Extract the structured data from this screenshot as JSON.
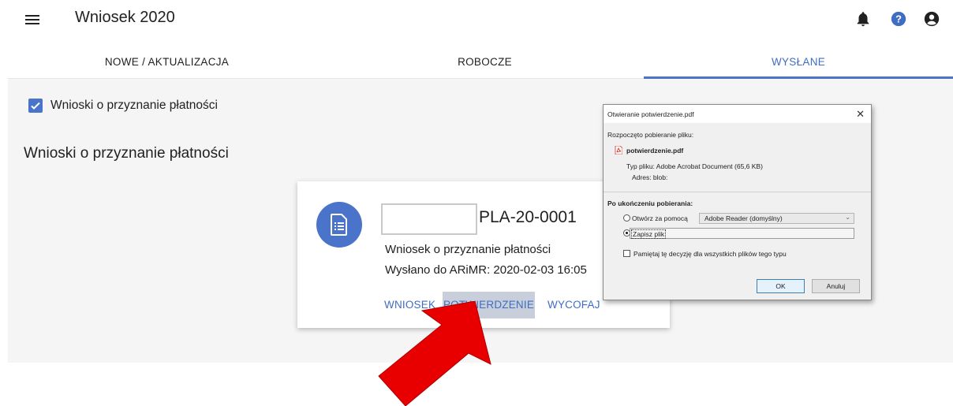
{
  "header": {
    "title": "Wniosek 2020"
  },
  "tabs": [
    {
      "label": "NOWE / AKTUALIZACJA"
    },
    {
      "label": "ROBOCZE"
    },
    {
      "label": "WYSŁANE",
      "active": true
    }
  ],
  "filter": {
    "label": "Wnioski o przyznanie płatności",
    "checked": true
  },
  "section": {
    "title": "Wnioski o przyznanie płatności"
  },
  "card": {
    "number": "PLA-20-0001",
    "type": "Wniosek o przyznanie płatności",
    "sent": "Wysłano do ARiMR: 2020-02-03 16:05",
    "actions": {
      "wniosek": "WNIOSEK",
      "potwierdzenie": "POTWIERDZENIE",
      "wycofaj": "WYCOFAJ"
    }
  },
  "dialog": {
    "title": "Otwieranie potwierdzenie.pdf",
    "started": "Rozpoczęto pobieranie pliku:",
    "filename": "potwierdzenie.pdf",
    "filetype": "Typ pliku: Adobe Acrobat Document (65,6 KB)",
    "source": "Adres: blob:",
    "after_label": "Po ukończeniu pobierania:",
    "open_with": "Otwórz za pomocą",
    "open_app": "Adobe Reader  (domyślny)",
    "save_file": "Zapisz plik",
    "remember": "Pamiętaj tę decyzję dla wszystkich plików tego typu",
    "ok": "OK",
    "cancel": "Anuluj",
    "selected_option": "save"
  },
  "colors": {
    "accent": "#4a74c9",
    "tab_active_text": "#3f6dc4",
    "highlight_button": "#c9cfda",
    "arrow": "#e80000"
  },
  "icons": {
    "menu": "hamburger-icon",
    "notifications": "bell-icon",
    "help": "help-icon",
    "account": "account-icon",
    "document": "document-icon",
    "pdf": "pdf-icon"
  }
}
